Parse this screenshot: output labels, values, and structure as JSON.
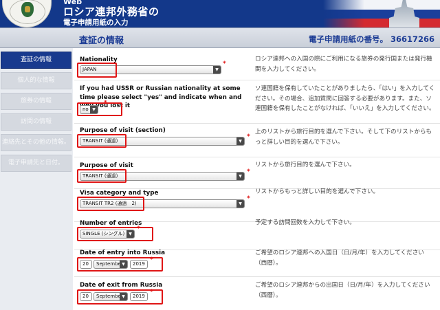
{
  "header": {
    "top_text": "Web",
    "title": "ロシア連邦外務省の",
    "subtitle": "電子申請用紙の入力"
  },
  "section": {
    "title": "査証の情報",
    "application_number": "電子申請用紙の番号。 36617266"
  },
  "sidebar": {
    "items": [
      {
        "label": "査証の情報",
        "active": true
      },
      {
        "label": "個人的な情報",
        "active": false
      },
      {
        "label": "旅券の情報",
        "active": false
      },
      {
        "label": "訪問の情報",
        "active": false
      },
      {
        "label": "連絡先とその他の情報。",
        "active": false
      },
      {
        "label": "電子申請先と日付。",
        "active": false
      }
    ]
  },
  "form": {
    "nationality": {
      "label": "Nationality",
      "value": "JAPAN",
      "help": "ロシア連邦への入国の際にご利用になる旅券の発行国または発行機関を入力してください。"
    },
    "ussr": {
      "label": "If you had USSR or Russian nationality at some time please select \"yes\" and indicate when and why you lost it",
      "value": "no",
      "help": "ソ連国籍を保有していたことがありましたら、「はい」を入力してください。その場合、追加質問に回答する必要があります。また、ソ連国籍を保有したことがなければ、「いいえ」を入力してください。"
    },
    "purpose_section": {
      "label": "Purpose of visit (section)",
      "value": "TRANSIT (通過)",
      "help": "上のリストから旅行目的を選んで下さい。そして下のリストからもっと詳しい目的を選んで下さい。"
    },
    "purpose": {
      "label": "Purpose of visit",
      "value": "TRANSIT (通過)",
      "help": "リストから旅行目的を選んで下さい。"
    },
    "visa_category": {
      "label": "Visa category and type",
      "value": "TRANSIT TR2 (通過　2)",
      "help": "リストからもっと詳しい目的を選んで下さい。"
    },
    "entries": {
      "label": "Number of entries",
      "value": "SINGLE (シングル)",
      "help": "予定する訪問回数を入力して下さい。"
    },
    "entry_date": {
      "label": "Date of entry into Russia",
      "day": "20",
      "month": "Septembe",
      "year": "2019",
      "help": "ご希望のロシア連邦への入国日（日/月/年）を入力してください（西暦）。"
    },
    "exit_date": {
      "label": "Date of exit from Russia",
      "day": "20",
      "month": "Septembe",
      "year": "2019",
      "help": "ご希望のロシア連邦からの出国日（日/月/年）を入力してください（西暦）。"
    },
    "required_mark": "*",
    "dropdown_arrow": "▼"
  },
  "colors": {
    "header_blue": "#13388a",
    "nav_active": "#193a8e",
    "highlight_red": "#e01515"
  }
}
